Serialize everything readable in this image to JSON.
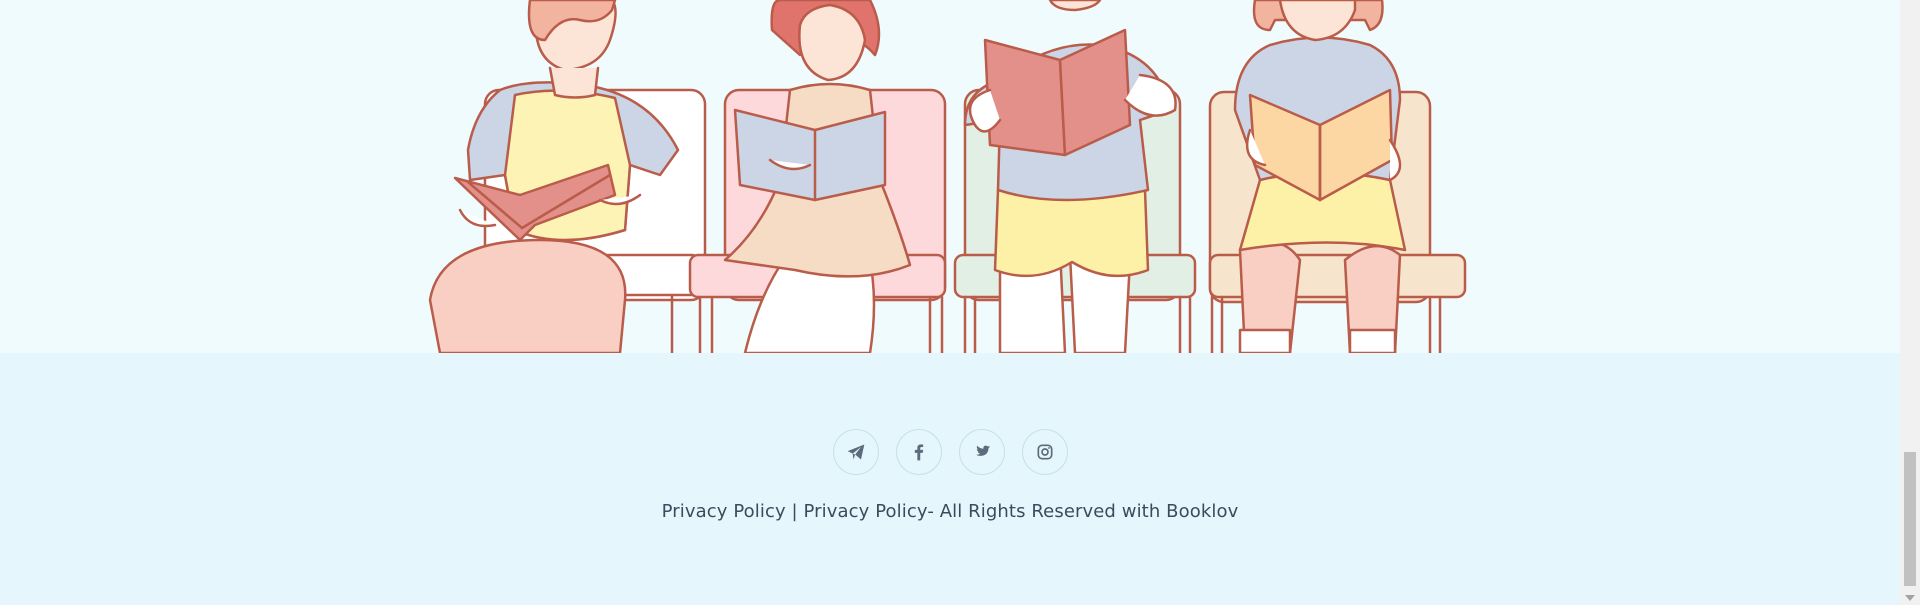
{
  "colors": {
    "hero_background": "#f0fbfe",
    "footer_background": "#e5f7fd",
    "text": "#3e4a5c",
    "icon": "#5d6b7c"
  },
  "footer": {
    "social_links": [
      {
        "icon": "telegram-icon",
        "label": "Telegram"
      },
      {
        "icon": "facebook-icon",
        "label": "Facebook"
      },
      {
        "icon": "twitter-icon",
        "label": "Twitter"
      },
      {
        "icon": "instagram-icon",
        "label": "Instagram"
      }
    ],
    "privacy_link_1": "Privacy Policy",
    "separator": " | ",
    "privacy_link_2": "Privacy Policy",
    "rights_text": "- All Rights Reserved with Booklov"
  }
}
